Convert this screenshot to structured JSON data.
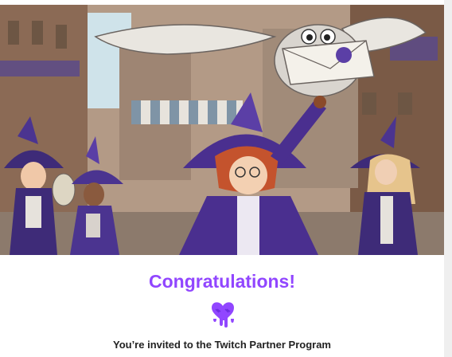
{
  "email": {
    "title": "Congratulations!",
    "subtitle": "You’re invited to the Twitch Partner Program",
    "hero_icon": "magical-market-illustration",
    "badge_icon": "melting-purple-heart-icon"
  },
  "colors": {
    "brand_purple": "#9146ff",
    "background": "#ffffff",
    "text": "#222222"
  }
}
